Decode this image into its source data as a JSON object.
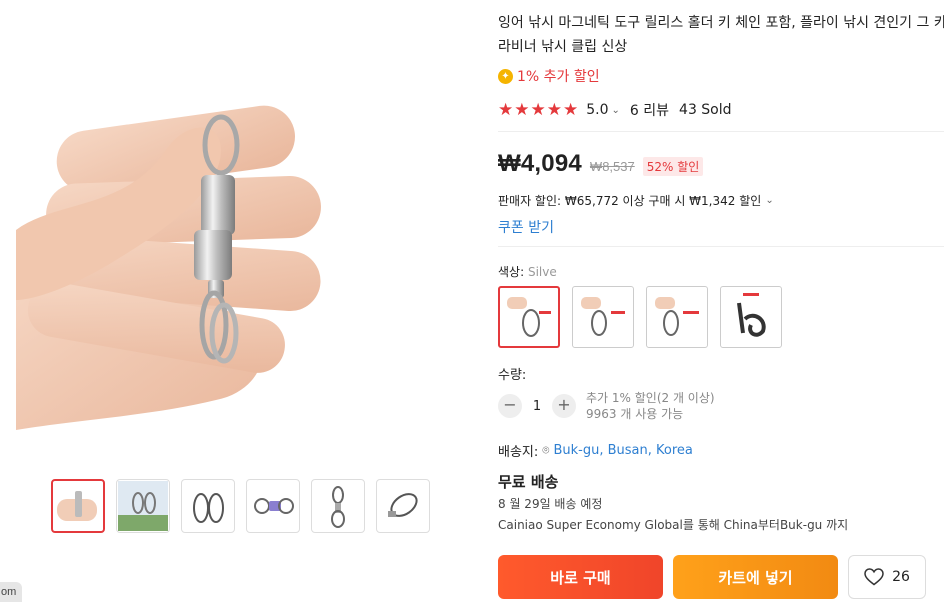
{
  "product": {
    "title": "잉어 낚시 마그네틱 도구 릴리스 홀더 키 체인 포함, 플라이 낚시 견인기 그 카라비너 낚시 클립 신상",
    "extra_discount": "1% 추가 할인",
    "rating": "5.0",
    "reviews": "6 리뷰",
    "sold": "43 Sold",
    "price": "₩4,094",
    "original_price": "₩8,537",
    "discount_badge": "52% 할인",
    "seller_discount": "판매자 할인: ₩65,772 이상 구매 시 ₩1,342 할인",
    "coupon_link": "쿠폰 받기"
  },
  "variant": {
    "label": "색상:",
    "selected": "Silve",
    "options": [
      "option-1",
      "option-2",
      "option-3",
      "option-4"
    ]
  },
  "quantity": {
    "label": "수량:",
    "value": "1",
    "minus": "−",
    "plus": "+",
    "note_line1": "추가 1% 할인(2 개 이상)",
    "note_line2": "9963 개 사용 가능"
  },
  "shipping": {
    "label": "배송지:",
    "location": "Buk-gu, Busan, Korea",
    "free": "무료 배송",
    "eta": "8 월 29일 배송 예정",
    "carrier": "Cainiao Super Economy Global를 통해 China부터Buk-gu 까지"
  },
  "actions": {
    "buy_now": "바로 구매",
    "add_to_cart": "카트에 넣기",
    "wishlist_count": "26"
  },
  "site_tag": "om",
  "colors": {
    "accent": "#e4393c",
    "link": "#2e7fd1",
    "buy": "#f4512b",
    "cart": "#f7961a",
    "coin": "#f5b400"
  }
}
